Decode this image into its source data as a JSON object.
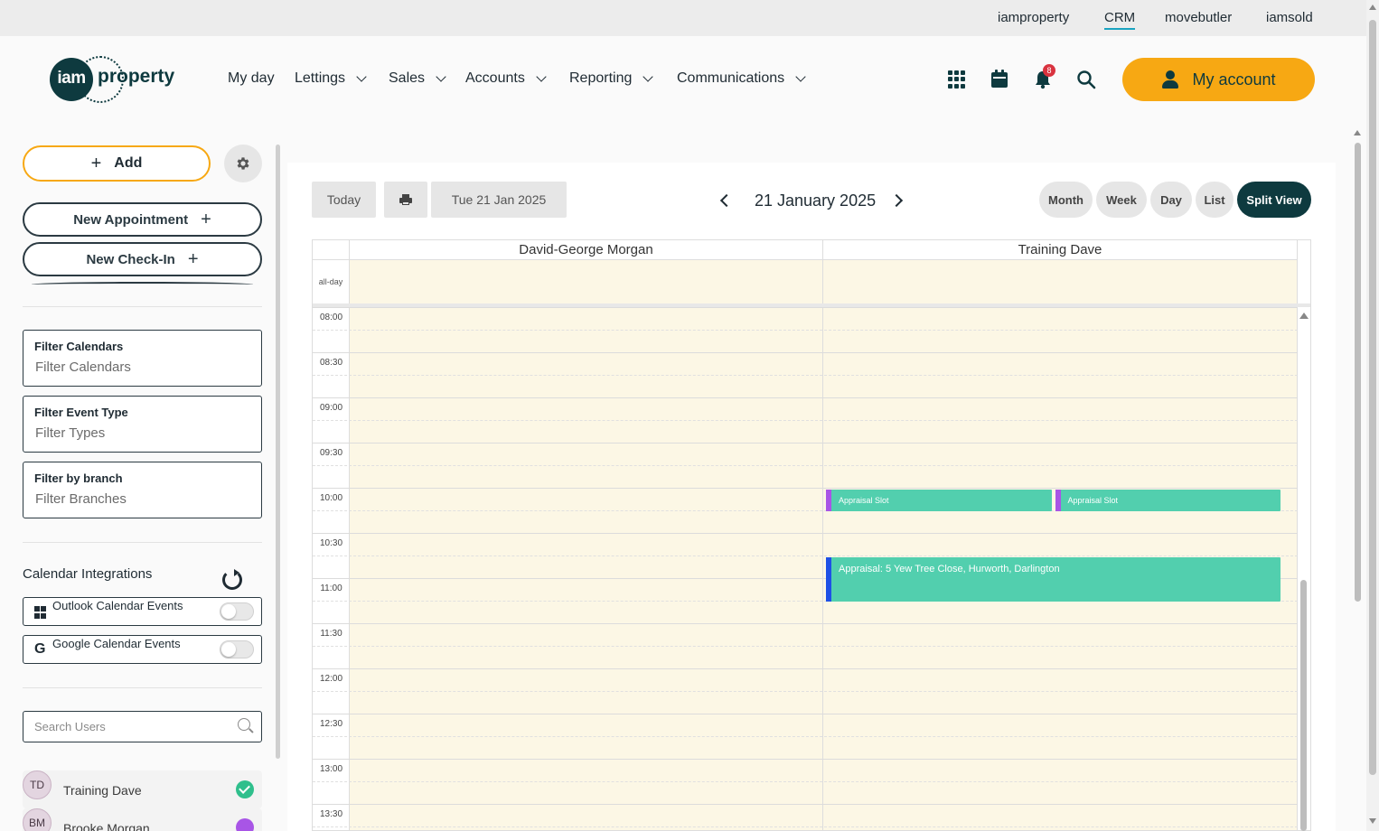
{
  "topbar": {
    "links": [
      {
        "label": "iamproperty",
        "active": false
      },
      {
        "label": "CRM",
        "active": true
      },
      {
        "label": "movebutler",
        "active": false
      },
      {
        "label": "iamsold",
        "active": false
      }
    ]
  },
  "brand": {
    "logo_circle": "iam",
    "logo_text": "property"
  },
  "nav": {
    "items": [
      {
        "label": "My day",
        "dropdown": false
      },
      {
        "label": "Lettings",
        "dropdown": true
      },
      {
        "label": "Sales",
        "dropdown": true
      },
      {
        "label": "Accounts",
        "dropdown": true
      },
      {
        "label": "Reporting",
        "dropdown": true
      },
      {
        "label": "Communications",
        "dropdown": true
      }
    ],
    "notification_count": "8",
    "account_label": "My account"
  },
  "sidebar": {
    "add_label": "Add",
    "new_appointment_label": "New Appointment",
    "new_checkin_label": "New Check-In",
    "filters": [
      {
        "label": "Filter Calendars",
        "placeholder": "Filter Calendars"
      },
      {
        "label": "Filter Event Type",
        "placeholder": "Filter Types"
      },
      {
        "label": "Filter by branch",
        "placeholder": "Filter Branches"
      }
    ],
    "integrations_title": "Calendar Integrations",
    "integrations": [
      {
        "label": "Outlook Calendar Events",
        "icon": "windows-icon",
        "enabled": false
      },
      {
        "label": "Google Calendar Events",
        "icon": "google-icon",
        "enabled": false
      }
    ],
    "search_placeholder": "Search Users",
    "users": [
      {
        "initials": "TD",
        "name": "Training Dave",
        "status": "checked",
        "color": "#2fbf8c"
      },
      {
        "initials": "BM",
        "name": "Brooke Morgan",
        "status": "dot",
        "color": "#a855e6"
      }
    ]
  },
  "calendar": {
    "toolbar": {
      "today_label": "Today",
      "date_display": "Tue 21 Jan 2025",
      "title": "21 January 2025",
      "views": [
        {
          "label": "Month",
          "active": false
        },
        {
          "label": "Week",
          "active": false
        },
        {
          "label": "Day",
          "active": false
        },
        {
          "label": "List",
          "active": false
        },
        {
          "label": "Split View",
          "active": true
        }
      ]
    },
    "columns": [
      "David-George Morgan",
      "Training Dave"
    ],
    "allday_label": "all-day",
    "time_slots": [
      "08:00",
      "08:30",
      "09:00",
      "09:30",
      "10:00",
      "10:30",
      "11:00",
      "11:30",
      "12:00",
      "12:30",
      "13:00",
      "13:30"
    ],
    "events": [
      {
        "title": "Appraisal Slot",
        "column": 1,
        "start": "10:00",
        "end": "10:15",
        "accent": "#a855e6",
        "slot": 0
      },
      {
        "title": "Appraisal Slot",
        "column": 1,
        "start": "10:00",
        "end": "10:15",
        "accent": "#a855e6",
        "slot": 1
      },
      {
        "title": "Appraisal: 5 Yew Tree Close, Hurworth, Darlington",
        "column": 1,
        "start": "10:45",
        "end": "11:15",
        "accent": "#1e50e6",
        "slot": 0
      }
    ],
    "colors": {
      "day_bg": "#fcf7e5",
      "event_bg": "#52cfae",
      "primary": "#0e3a3f",
      "accent": "#f7a813"
    }
  }
}
